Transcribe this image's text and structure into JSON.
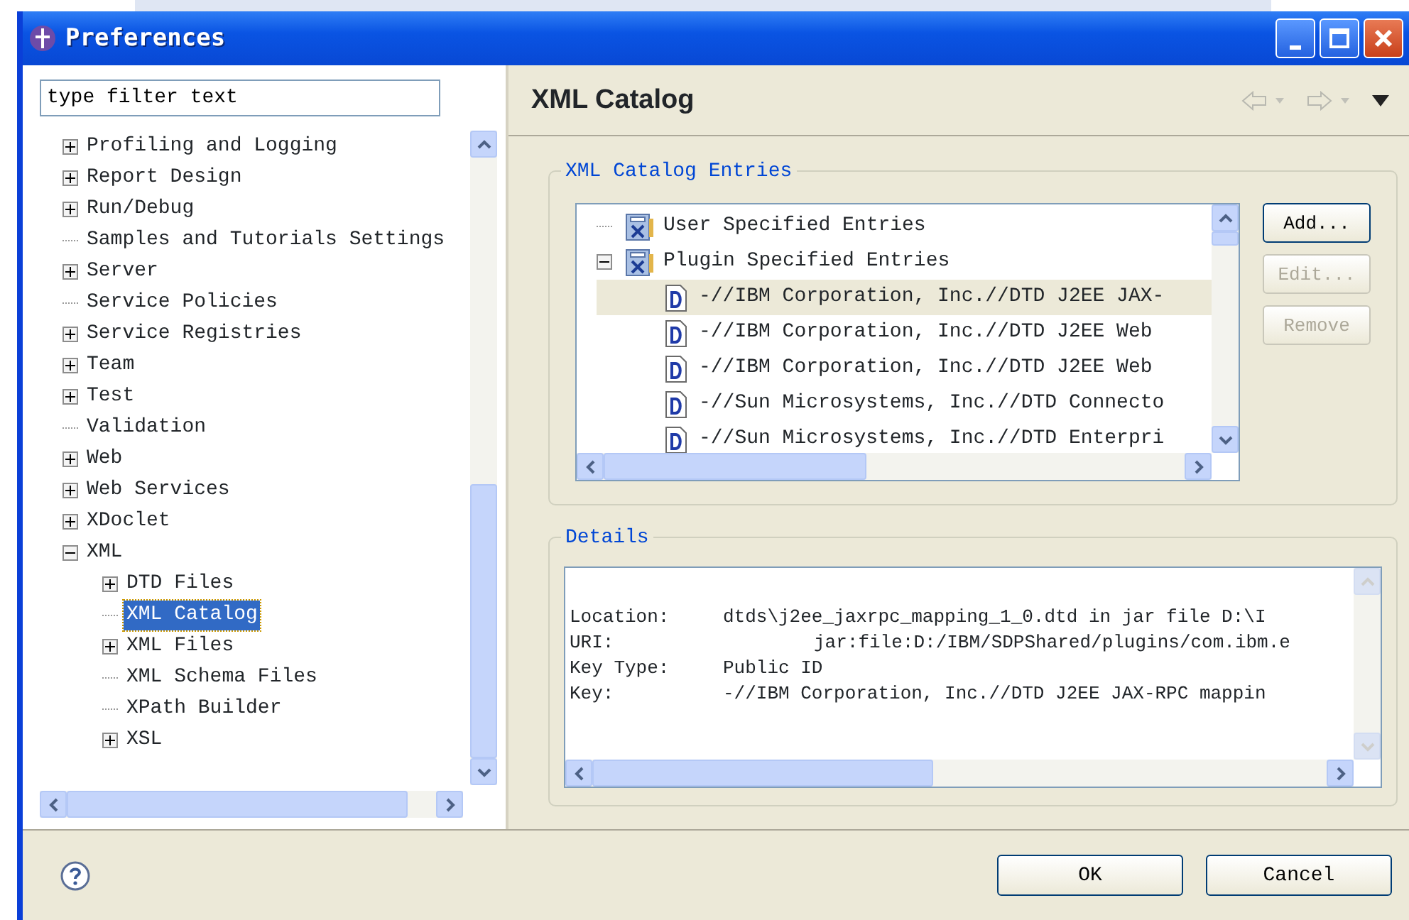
{
  "window": {
    "title": "Preferences"
  },
  "filter": {
    "value": "type filter text"
  },
  "tree": [
    {
      "label": "Profiling and Logging",
      "kind": "collapsed",
      "selected": false
    },
    {
      "label": "Report Design",
      "kind": "collapsed",
      "selected": false
    },
    {
      "label": "Run/Debug",
      "kind": "collapsed",
      "selected": false
    },
    {
      "label": "Samples and Tutorials Settings",
      "kind": "leaf",
      "selected": false
    },
    {
      "label": "Server",
      "kind": "collapsed",
      "selected": false
    },
    {
      "label": "Service Policies",
      "kind": "leaf",
      "selected": false
    },
    {
      "label": "Service Registries",
      "kind": "collapsed",
      "selected": false
    },
    {
      "label": "Team",
      "kind": "collapsed",
      "selected": false
    },
    {
      "label": "Test",
      "kind": "collapsed",
      "selected": false
    },
    {
      "label": "Validation",
      "kind": "leaf",
      "selected": false
    },
    {
      "label": "Web",
      "kind": "collapsed",
      "selected": false
    },
    {
      "label": "Web Services",
      "kind": "collapsed",
      "selected": false
    },
    {
      "label": "XDoclet",
      "kind": "collapsed",
      "selected": false
    },
    {
      "label": "XML",
      "kind": "expanded",
      "selected": false,
      "children": [
        {
          "label": "DTD Files",
          "kind": "collapsed",
          "selected": false
        },
        {
          "label": "XML Catalog",
          "kind": "leaf",
          "selected": true
        },
        {
          "label": "XML Files",
          "kind": "collapsed",
          "selected": false
        },
        {
          "label": "XML Schema Files",
          "kind": "leaf",
          "selected": false
        },
        {
          "label": "XPath Builder",
          "kind": "leaf",
          "selected": false
        },
        {
          "label": "XSL",
          "kind": "collapsed",
          "selected": false
        }
      ]
    }
  ],
  "page": {
    "title": "XML Catalog"
  },
  "catalog": {
    "legend": "XML Catalog Entries",
    "entries": [
      {
        "label": "User Specified Entries",
        "kind": "leaf",
        "selected": false
      },
      {
        "label": "Plugin Specified Entries",
        "kind": "expanded",
        "selected": false,
        "children": [
          {
            "label": "-//IBM Corporation, Inc.//DTD J2EE JAX-",
            "selected": true
          },
          {
            "label": "-//IBM Corporation, Inc.//DTD J2EE Web",
            "selected": false
          },
          {
            "label": "-//IBM Corporation, Inc.//DTD J2EE Web",
            "selected": false
          },
          {
            "label": "-//Sun Microsystems, Inc.//DTD Connecto",
            "selected": false
          },
          {
            "label": "-//Sun Microsystems, Inc.//DTD Enterpri",
            "selected": false
          }
        ]
      }
    ],
    "buttons": [
      {
        "label": "Add...",
        "disabled": false
      },
      {
        "label": "Edit...",
        "disabled": true
      },
      {
        "label": "Remove",
        "disabled": true
      }
    ]
  },
  "details": {
    "legend": "Details",
    "rows": [
      {
        "label": "Location:",
        "value": "dtds\\j2ee_jaxrpc_mapping_1_0.dtd in jar file D:\\I"
      },
      {
        "label": "URI:",
        "value": "jar:file:D:/IBM/SDPShared/plugins/com.ibm.e"
      },
      {
        "label": "Key Type:",
        "value": "Public ID"
      },
      {
        "label": "Key:",
        "value": "-//IBM Corporation, Inc.//DTD J2EE JAX-RPC mappin"
      }
    ]
  },
  "footer": {
    "buttons": [
      {
        "label": "OK"
      },
      {
        "label": "Cancel"
      }
    ]
  }
}
